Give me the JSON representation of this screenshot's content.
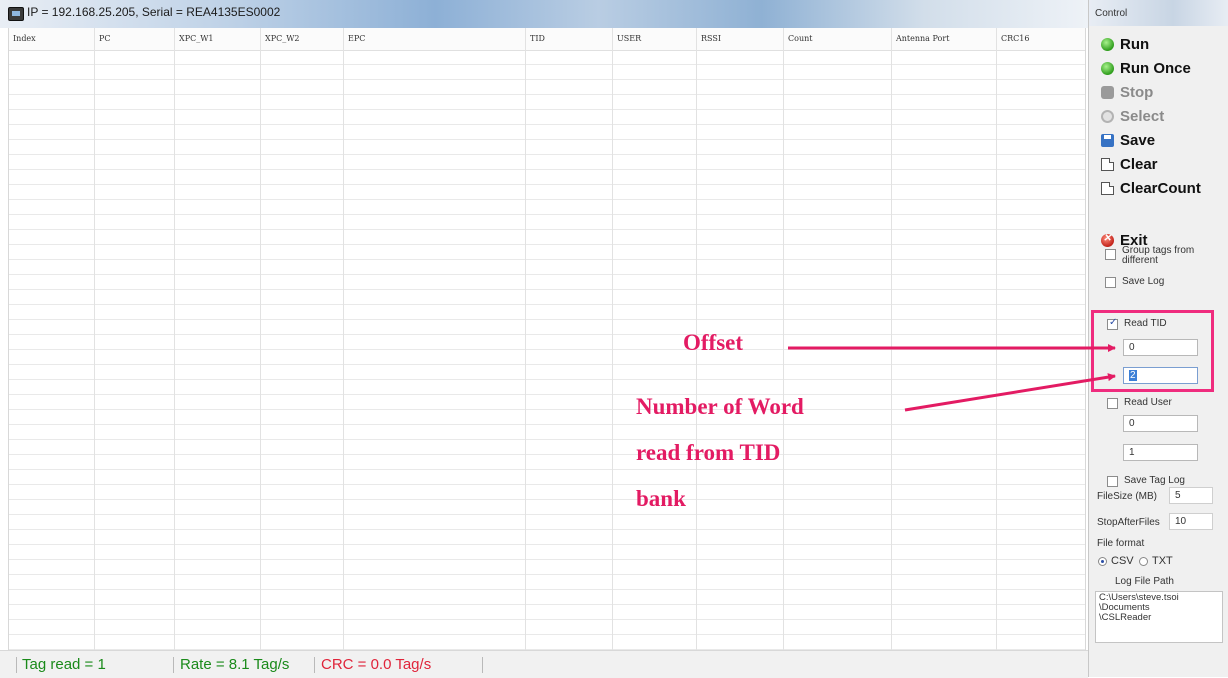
{
  "window": {
    "title": "IP = 192.168.25.205, Serial = REA4135ES0002"
  },
  "table": {
    "columns": [
      "Index",
      "PC",
      "XPC_W1",
      "XPC_W2",
      "EPC",
      "TID",
      "USER",
      "RSSI",
      "Count",
      "Antenna Port",
      "CRC16"
    ],
    "rows": []
  },
  "status": {
    "tag_read": "Tag read = 1",
    "rate": "Rate = 8.1 Tag/s",
    "crc": "CRC = 0.0 Tag/s",
    "tag_read_color": "#1a8a1a",
    "rate_color": "#1a8a1a",
    "crc_color": "#e0243a"
  },
  "control": {
    "title": "Control",
    "buttons": {
      "run": "Run",
      "run_once": "Run Once",
      "stop": "Stop",
      "select": "Select",
      "save": "Save",
      "clear": "Clear",
      "clear_count": "ClearCount",
      "exit": "Exit"
    },
    "group_tags": {
      "label_line1": "Group tags from",
      "label_line2": "different",
      "checked": false
    },
    "save_log": {
      "label": "Save Log",
      "checked": false
    },
    "read_tid": {
      "label": "Read TID",
      "checked": true,
      "offset": "0",
      "word_count": "2"
    },
    "read_user": {
      "label": "Read User",
      "checked": false,
      "offset": "0",
      "word_count": "1"
    },
    "save_tag_log": {
      "label": "Save Tag Log",
      "checked": false
    },
    "file_size": {
      "label": "FileSize (MB)",
      "value": "5"
    },
    "stop_after_files": {
      "label": "StopAfterFiles",
      "value": "10"
    },
    "file_format": {
      "label": "File format",
      "options": [
        "CSV",
        "TXT"
      ],
      "selected": "CSV"
    },
    "log_file_path": {
      "label": "Log File Path",
      "value": "C:\\Users\\steve.tsoi\n\\Documents\n\\CSLReader"
    }
  },
  "annotations": {
    "offset": "Offset",
    "words_line1": "Number of Word",
    "words_line2": "read from TID",
    "words_line3": "bank",
    "color": "#e31b63"
  }
}
